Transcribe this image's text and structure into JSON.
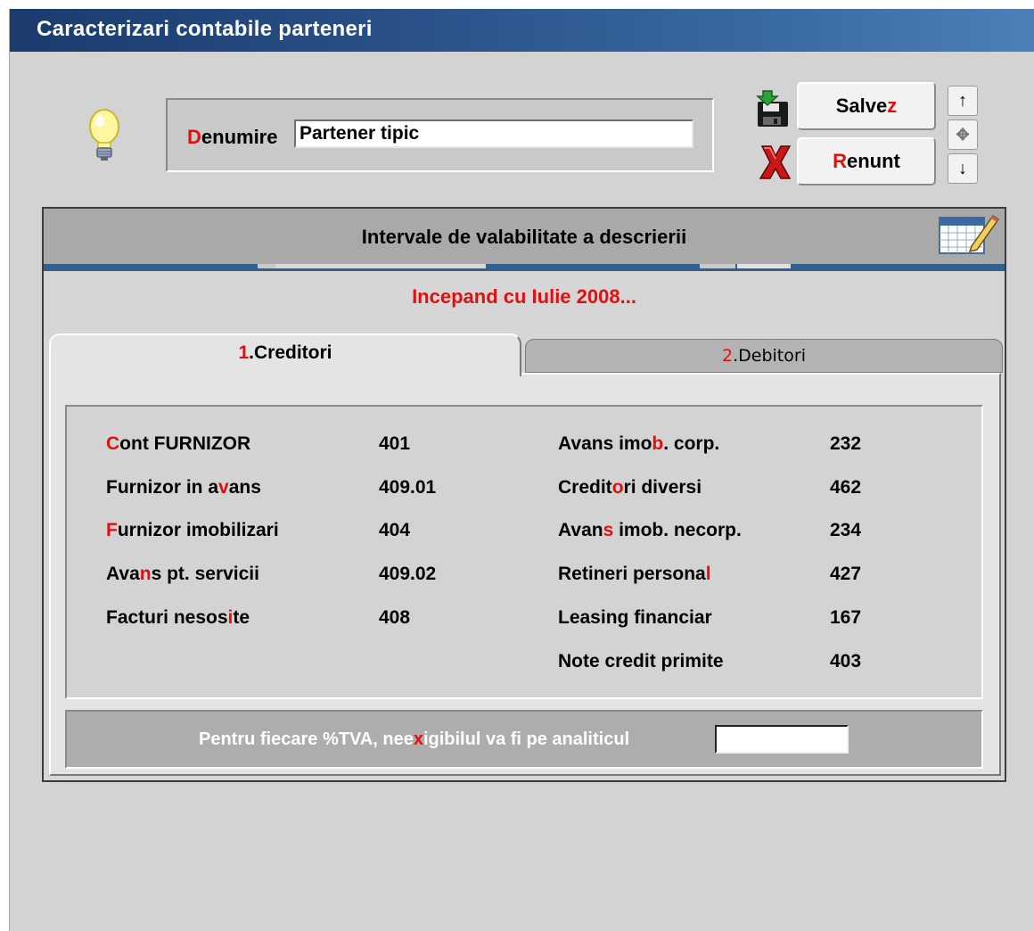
{
  "window": {
    "title": "Caracterizari contabile parteneri"
  },
  "form": {
    "name_label_hotkey": "D",
    "name_label_rest": "enumire",
    "name_value": "Partener tipic"
  },
  "buttons": {
    "save_pre": "Salve",
    "save_hotkey": "z",
    "cancel_hotkey": "R",
    "cancel_rest": "enunt"
  },
  "nav": {
    "up": "↑",
    "move": "✥",
    "down": "↓"
  },
  "validity": {
    "header": "Intervale de valabilitate a descrierii",
    "interval": "Incepand cu Iulie 2008..."
  },
  "tabs": [
    {
      "num": "1",
      "label": ".Creditori",
      "active": true
    },
    {
      "num": "2",
      "label": ".Debitori",
      "active": false
    }
  ],
  "accounts_left": [
    {
      "pre": "",
      "hk": "C",
      "post": "ont FURNIZOR",
      "value": "401"
    },
    {
      "pre": "Furnizor in a",
      "hk": "v",
      "post": "ans",
      "value": "409.01"
    },
    {
      "pre": "",
      "hk": "F",
      "post": "urnizor imobilizari",
      "value": "404"
    },
    {
      "pre": "Ava",
      "hk": "n",
      "post": "s pt. servicii",
      "value": "409.02"
    },
    {
      "pre": "Facturi nesos",
      "hk": "i",
      "post": "te",
      "value": "408"
    }
  ],
  "accounts_right": [
    {
      "pre": "Avans imo",
      "hk": "b",
      "post": ". corp.",
      "value": "232"
    },
    {
      "pre": "Credit",
      "hk": "o",
      "post": "ri diversi",
      "value": "462"
    },
    {
      "pre": "Avan",
      "hk": "s",
      "post": " imob. necorp.",
      "value": "234"
    },
    {
      "pre": "Retineri persona",
      "hk": "l",
      "post": "",
      "value": "427"
    },
    {
      "pre": "Leasing financiar",
      "hk": "",
      "post": "",
      "value": "167"
    },
    {
      "pre": "Note credit primite",
      "hk": "",
      "post": "",
      "value": "403"
    }
  ],
  "vat": {
    "pre": "Pentru fiecare %TVA, nee",
    "hk": "x",
    "post": "igibilul va fi pe analiticul",
    "value": ""
  },
  "colors": {
    "hotkey": "#e01010",
    "titlebar": "#2a5289"
  }
}
